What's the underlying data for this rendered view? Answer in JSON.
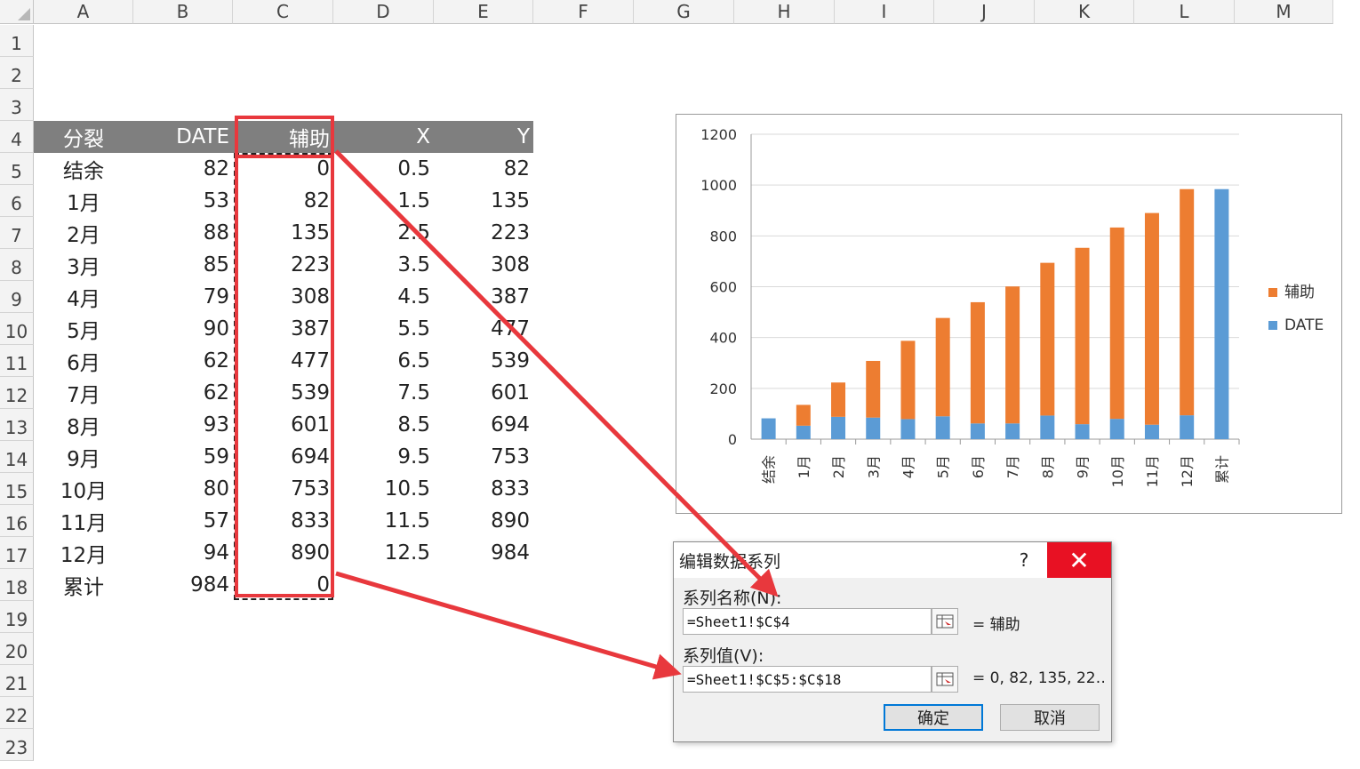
{
  "columns": [
    "A",
    "B",
    "C",
    "D",
    "E",
    "F",
    "G",
    "H",
    "I",
    "J",
    "K",
    "L",
    "M"
  ],
  "rows": [
    "1",
    "2",
    "3",
    "4",
    "5",
    "6",
    "7",
    "8",
    "9",
    "10",
    "11",
    "12",
    "13",
    "14",
    "15",
    "16",
    "17",
    "18",
    "19",
    "20",
    "21",
    "22",
    "23"
  ],
  "table": {
    "headers": [
      "分裂",
      "DATE",
      "辅助",
      "X",
      "Y"
    ],
    "rows": [
      {
        "label": "结余",
        "date": "82",
        "aux": "0",
        "x": "0.5",
        "y": "82"
      },
      {
        "label": "1月",
        "date": "53",
        "aux": "82",
        "x": "1.5",
        "y": "135"
      },
      {
        "label": "2月",
        "date": "88",
        "aux": "135",
        "x": "2.5",
        "y": "223"
      },
      {
        "label": "3月",
        "date": "85",
        "aux": "223",
        "x": "3.5",
        "y": "308"
      },
      {
        "label": "4月",
        "date": "79",
        "aux": "308",
        "x": "4.5",
        "y": "387"
      },
      {
        "label": "5月",
        "date": "90",
        "aux": "387",
        "x": "5.5",
        "y": "477"
      },
      {
        "label": "6月",
        "date": "62",
        "aux": "477",
        "x": "6.5",
        "y": "539"
      },
      {
        "label": "7月",
        "date": "62",
        "aux": "539",
        "x": "7.5",
        "y": "601"
      },
      {
        "label": "8月",
        "date": "93",
        "aux": "601",
        "x": "8.5",
        "y": "694"
      },
      {
        "label": "9月",
        "date": "59",
        "aux": "694",
        "x": "9.5",
        "y": "753"
      },
      {
        "label": "10月",
        "date": "80",
        "aux": "753",
        "x": "10.5",
        "y": "833"
      },
      {
        "label": "11月",
        "date": "57",
        "aux": "833",
        "x": "11.5",
        "y": "890"
      },
      {
        "label": "12月",
        "date": "94",
        "aux": "890",
        "x": "12.5",
        "y": "984"
      },
      {
        "label": "累计",
        "date": "984",
        "aux": "0",
        "x": "",
        "y": ""
      }
    ]
  },
  "chart_data": {
    "type": "bar",
    "stacked": true,
    "categories": [
      "结余",
      "1月",
      "2月",
      "3月",
      "4月",
      "5月",
      "6月",
      "7月",
      "8月",
      "9月",
      "10月",
      "11月",
      "12月",
      "累计"
    ],
    "series": [
      {
        "name": "DATE",
        "color": "#5b9bd5",
        "values": [
          82,
          53,
          88,
          85,
          79,
          90,
          62,
          62,
          93,
          59,
          80,
          57,
          94,
          984
        ]
      },
      {
        "name": "辅助",
        "color": "#ed7d31",
        "values": [
          0,
          82,
          135,
          223,
          308,
          387,
          477,
          539,
          601,
          694,
          753,
          833,
          890,
          0
        ]
      }
    ],
    "yticks": [
      "0",
      "200",
      "400",
      "600",
      "800",
      "1000",
      "1200"
    ],
    "ylim": [
      0,
      1200
    ],
    "grid": true,
    "legend_position": "right",
    "legend": [
      "辅助",
      "DATE"
    ]
  },
  "dialog": {
    "title": "编辑数据系列",
    "help": "?",
    "close": "✕",
    "name_label": "系列名称(N):",
    "name_value": "=Sheet1!$C$4",
    "name_preview": "= 辅助",
    "values_label": "系列值(V):",
    "values_value": "=Sheet1!$C$5:$C$18",
    "values_preview": "= 0, 82, 135, 22…",
    "ok": "确定",
    "cancel": "取消"
  },
  "colors": {
    "accent_red": "#e8383d",
    "header_gray": "#7f7f7f",
    "orange": "#ed7d31",
    "blue": "#5b9bd5"
  }
}
